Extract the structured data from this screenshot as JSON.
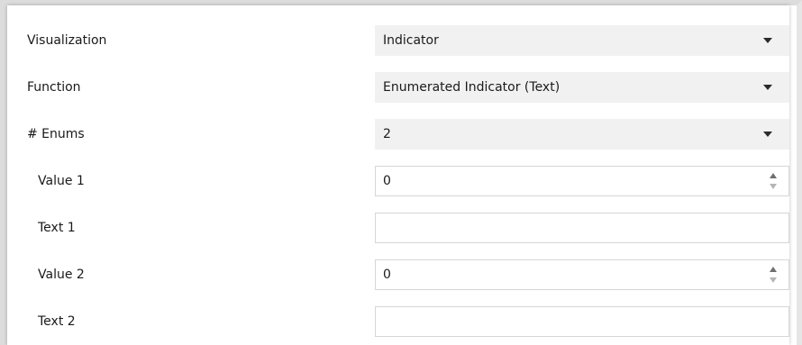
{
  "rows": [
    {
      "label": "Visualization",
      "type": "select",
      "value": "Indicator"
    },
    {
      "label": "Function",
      "type": "select",
      "value": "Enumerated Indicator (Text)"
    },
    {
      "label": "# Enums",
      "type": "select",
      "value": "2"
    },
    {
      "label": "Value 1",
      "type": "spinner",
      "value": "0"
    },
    {
      "label": "Text 1",
      "type": "text",
      "value": ""
    },
    {
      "label": "Value 2",
      "type": "spinner",
      "value": "0"
    },
    {
      "label": "Text 2",
      "type": "text",
      "value": ""
    }
  ],
  "icons": {
    "dropdown": "chevron-down-icon",
    "spinner_up": "spin-up-icon",
    "spinner_down": "spin-down-icon"
  },
  "colors": {
    "select_bg": "#f1f1f1",
    "input_border": "#d6d6d6",
    "text": "#1a1a1a"
  }
}
